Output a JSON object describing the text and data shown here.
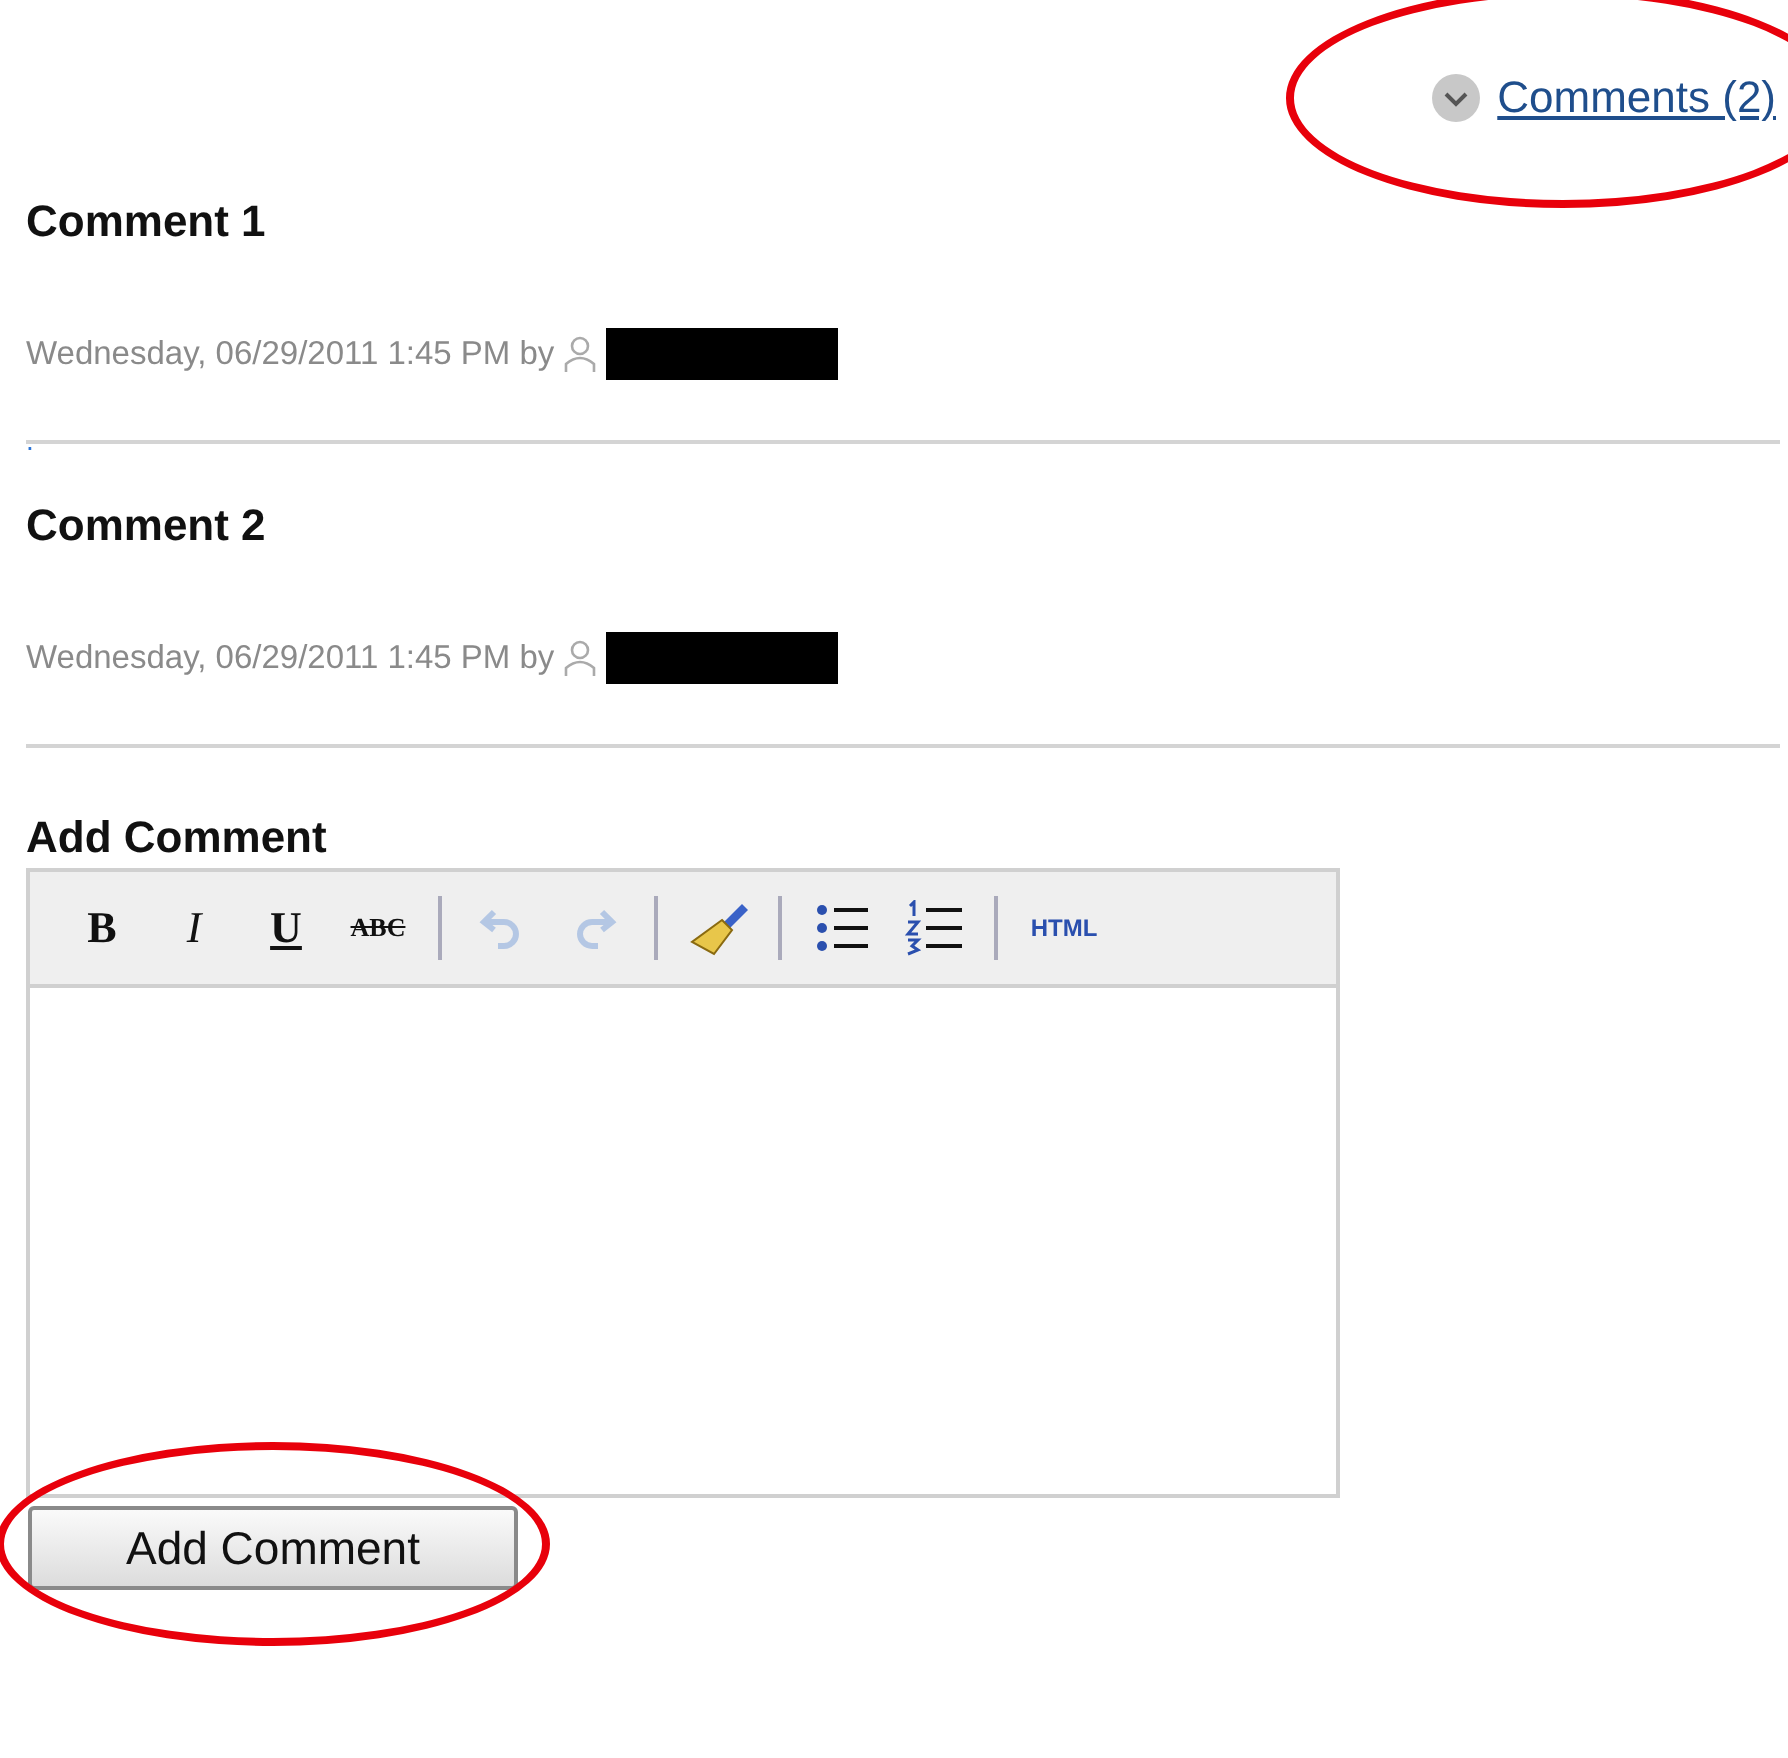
{
  "comments_toggle": {
    "label": "Comments (2)",
    "expanded": false,
    "circled": true
  },
  "comments": [
    {
      "title": "Comment 1",
      "meta": "Wednesday, 06/29/2011 1:45 PM by",
      "author_redacted": true,
      "body": "."
    },
    {
      "title": "Comment 2",
      "meta": "Wednesday, 06/29/2011 1:45 PM by",
      "author_redacted": true
    }
  ],
  "add_comment": {
    "heading": "Add Comment",
    "toolbar": [
      {
        "kind": "bold",
        "label": "B",
        "disabled": false
      },
      {
        "kind": "italic",
        "label": "I",
        "disabled": false
      },
      {
        "kind": "underline",
        "label": "U",
        "disabled": false
      },
      {
        "kind": "strike",
        "label": "ABC",
        "disabled": false
      },
      {
        "kind": "separator"
      },
      {
        "kind": "undo",
        "disabled": true
      },
      {
        "kind": "redo",
        "disabled": true
      },
      {
        "kind": "separator"
      },
      {
        "kind": "brush",
        "disabled": false
      },
      {
        "kind": "separator"
      },
      {
        "kind": "bullets",
        "disabled": false
      },
      {
        "kind": "numbers",
        "disabled": false
      },
      {
        "kind": "separator"
      },
      {
        "kind": "html",
        "label": "HTML",
        "disabled": false
      }
    ],
    "submit": {
      "label": "Add Comment",
      "circled": true
    }
  }
}
